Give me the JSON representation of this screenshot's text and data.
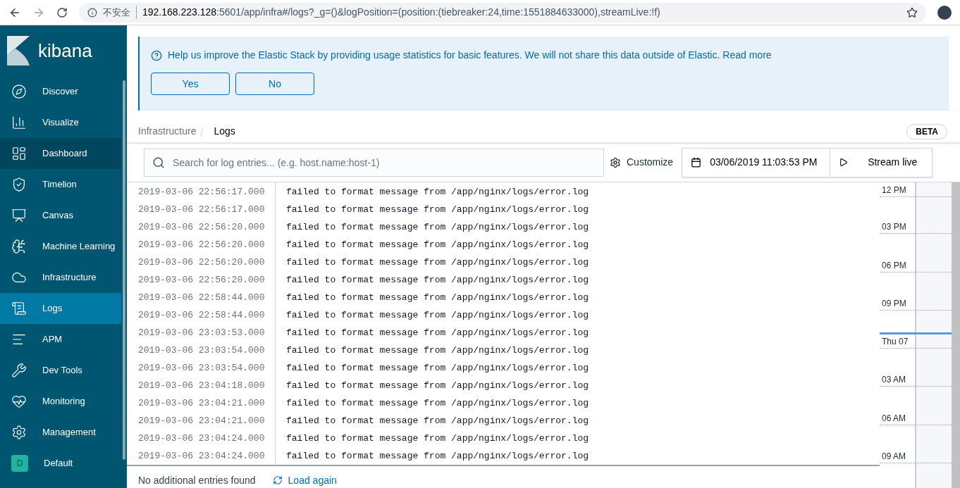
{
  "browser": {
    "security": "不安全",
    "url_host": "192.168.223.128",
    "url_rest": ":5601/app/infra#/logs?_g=()&logPosition=(position:(tiebreaker:24,time:1551884633000),streamLive:!f)"
  },
  "sidebar": {
    "brand": "kibana",
    "items": [
      {
        "kind": "app",
        "label": "Discover",
        "selected": false,
        "hovered": false
      },
      {
        "kind": "app",
        "label": "Visualize",
        "selected": false,
        "hovered": false
      },
      {
        "kind": "app",
        "label": "Dashboard",
        "selected": false,
        "hovered": true
      },
      {
        "kind": "app",
        "label": "Timelion",
        "selected": false,
        "hovered": false
      },
      {
        "kind": "app",
        "label": "Canvas",
        "selected": false,
        "hovered": false
      },
      {
        "kind": "app",
        "label": "Machine Learning",
        "selected": false,
        "hovered": false
      },
      {
        "kind": "app",
        "label": "Infrastructure",
        "selected": false,
        "hovered": false
      },
      {
        "kind": "app",
        "label": "Logs",
        "selected": true,
        "hovered": false
      },
      {
        "kind": "app",
        "label": "APM",
        "selected": false,
        "hovered": false
      },
      {
        "kind": "app",
        "label": "Dev Tools",
        "selected": false,
        "hovered": false
      },
      {
        "kind": "app",
        "label": "Monitoring",
        "selected": false,
        "hovered": false
      },
      {
        "kind": "app",
        "label": "Management",
        "selected": false,
        "hovered": false
      },
      {
        "kind": "space",
        "label": "Default",
        "avatar": "D",
        "selected": false,
        "hovered": false
      }
    ]
  },
  "banner": {
    "text": "Help us improve the Elastic Stack by providing usage statistics for basic features. We will not share this data outside of Elastic.",
    "link": "Read more",
    "buttons": [
      "Yes",
      "No"
    ]
  },
  "breadcrumbs": [
    "Infrastructure",
    "Logs"
  ],
  "badge": "BETA",
  "toolbar": {
    "search_placeholder": "Search for log entries... (e.g. host.name:host-1)",
    "customize": "Customize",
    "date": "03/06/2019 11:03:53 PM",
    "stream": "Stream live"
  },
  "log_rows": [
    {
      "time": "2019-03-06 22:56:17.000",
      "message": "failed to format message from /app/nginx/logs/error.log"
    },
    {
      "time": "2019-03-06 22:56:17.000",
      "message": "failed to format message from /app/nginx/logs/error.log"
    },
    {
      "time": "2019-03-06 22:56:20.000",
      "message": "failed to format message from /app/nginx/logs/error.log"
    },
    {
      "time": "2019-03-06 22:56:20.000",
      "message": "failed to format message from /app/nginx/logs/error.log"
    },
    {
      "time": "2019-03-06 22:56:20.000",
      "message": "failed to format message from /app/nginx/logs/error.log"
    },
    {
      "time": "2019-03-06 22:56:20.000",
      "message": "failed to format message from /app/nginx/logs/error.log"
    },
    {
      "time": "2019-03-06 22:58:44.000",
      "message": "failed to format message from /app/nginx/logs/error.log"
    },
    {
      "time": "2019-03-06 22:58:44.000",
      "message": "failed to format message from /app/nginx/logs/error.log"
    },
    {
      "time": "2019-03-06 23:03:53.000",
      "message": "failed to format message from /app/nginx/logs/error.log"
    },
    {
      "time": "2019-03-06 23:03:54.000",
      "message": "failed to format message from /app/nginx/logs/error.log"
    },
    {
      "time": "2019-03-06 23:03:54.000",
      "message": "failed to format message from /app/nginx/logs/error.log"
    },
    {
      "time": "2019-03-06 23:04:18.000",
      "message": "failed to format message from /app/nginx/logs/error.log"
    },
    {
      "time": "2019-03-06 23:04:21.000",
      "message": "failed to format message from /app/nginx/logs/error.log"
    },
    {
      "time": "2019-03-06 23:04:21.000",
      "message": "failed to format message from /app/nginx/logs/error.log"
    },
    {
      "time": "2019-03-06 23:04:24.000",
      "message": "failed to format message from /app/nginx/logs/error.log"
    },
    {
      "time": "2019-03-06 23:04:24.000",
      "message": "failed to format message from /app/nginx/logs/error.log"
    }
  ],
  "timeline": [
    {
      "label": "12 PM",
      "marker": false
    },
    {
      "label": "03 PM",
      "marker": false
    },
    {
      "label": "06 PM",
      "marker": false
    },
    {
      "label": "09 PM",
      "marker": false
    },
    {
      "label": "Thu 07",
      "marker": true
    },
    {
      "label": "03 AM",
      "marker": false
    },
    {
      "label": "06 AM",
      "marker": false
    },
    {
      "label": "09 AM",
      "marker": false
    }
  ],
  "footer": {
    "status": "No additional entries found",
    "action": "Load again"
  }
}
